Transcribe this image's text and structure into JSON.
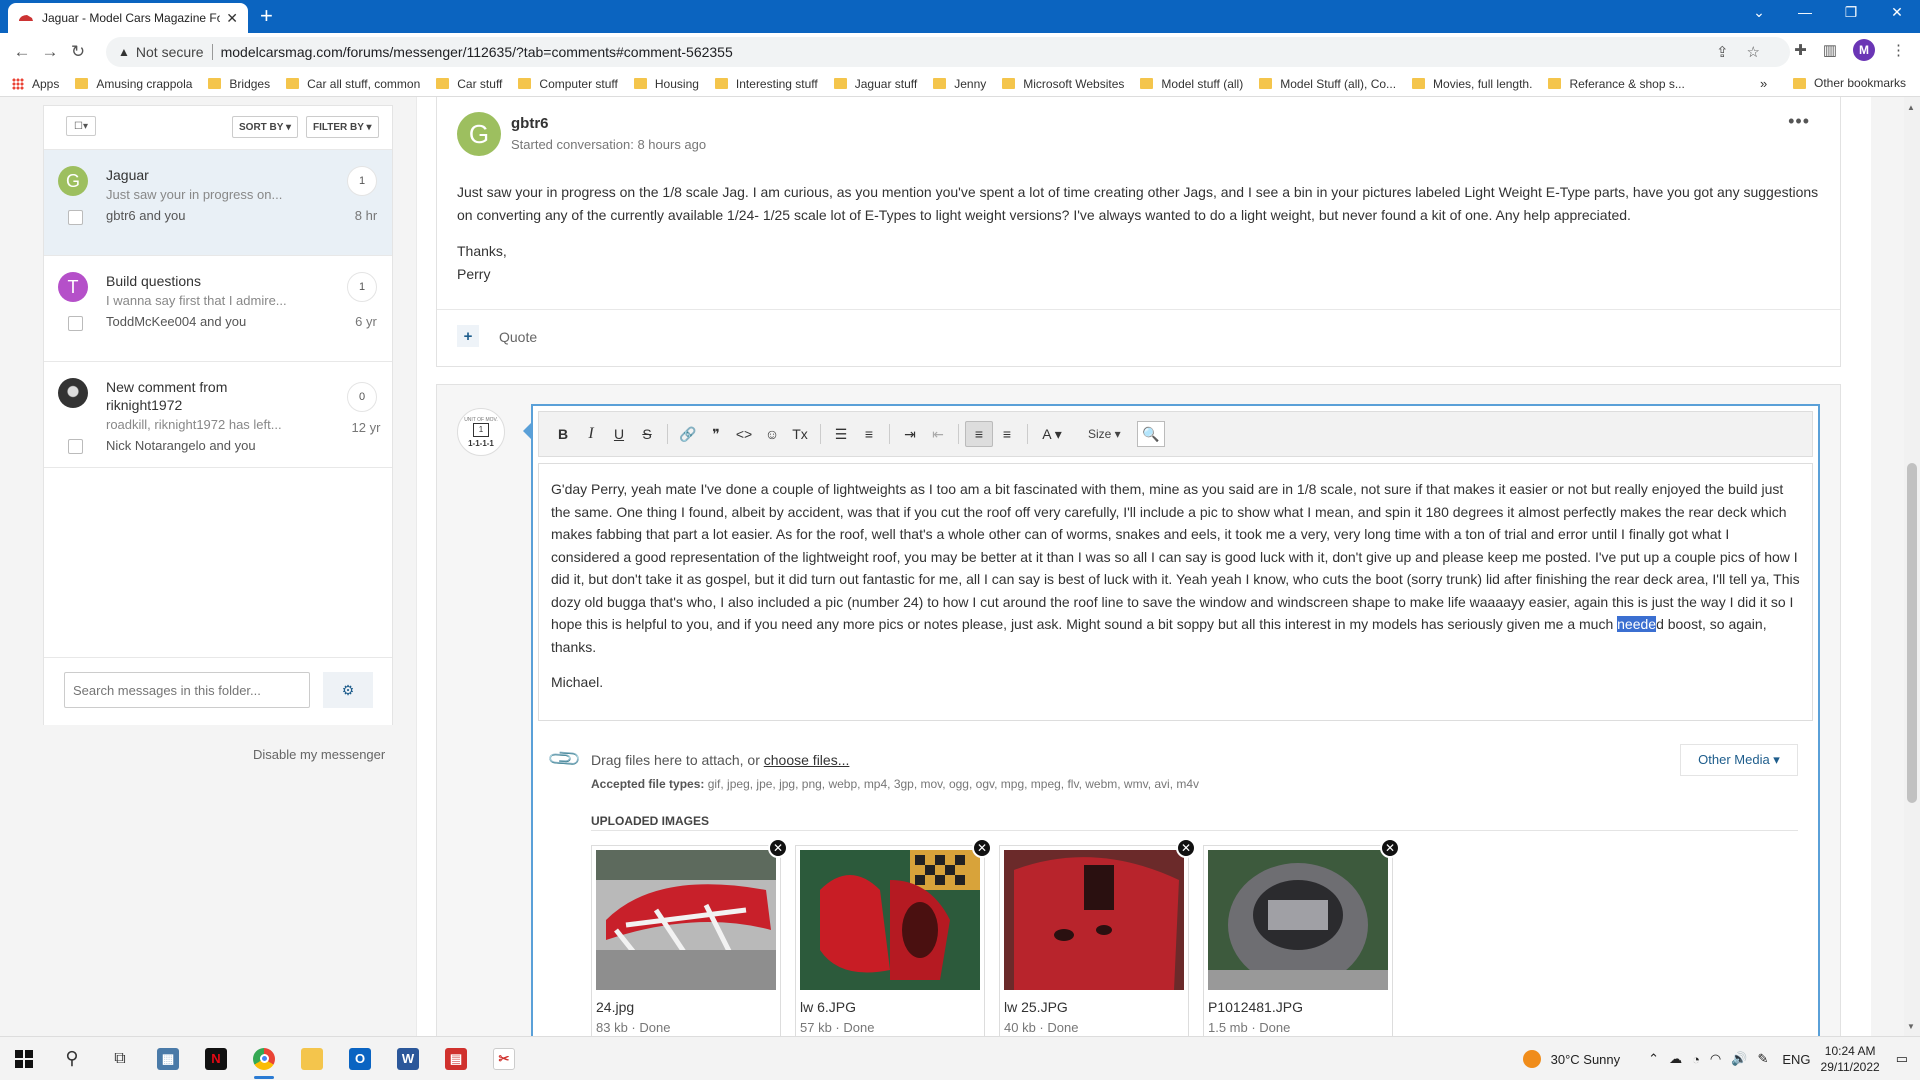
{
  "browser": {
    "tab_title": "Jaguar - Model Cars Magazine Fo",
    "tab_close": "✕",
    "new_tab": "+",
    "security": "Not secure",
    "url": "modelcarsmag.com/forums/messenger/112635/?tab=comments#comment-562355",
    "profile_initial": "M",
    "bookmarks": [
      "Apps",
      "Amusing crappola",
      "Bridges",
      "Car all stuff, common",
      "Car stuff",
      "Computer stuff",
      "Housing",
      "Interesting stuff",
      "Jaguar stuff",
      "Jenny",
      "Microsoft Websites",
      "Model stuff (all)",
      "Model Stuff (all), Co...",
      "Movies, full length.",
      "Referance & shop s..."
    ],
    "bookmarks_more": "»",
    "other_bookmarks": "Other bookmarks"
  },
  "sidebar": {
    "sort_label": "SORT BY ▾",
    "filter_label": "FILTER BY ▾",
    "conversations": [
      {
        "avatar": "G",
        "avatar_color": "#9dbf5f",
        "title": "Jaguar",
        "snippet": "Just saw your in progress on...",
        "participants": "gbtr6 and you",
        "count": "1",
        "age": "8 hr"
      },
      {
        "avatar": "T",
        "avatar_color": "#b550c9",
        "title": "Build questions",
        "snippet": "I wanna say first that I admire...",
        "participants": "ToddMcKee004 and you",
        "count": "1",
        "age": "6 yr"
      },
      {
        "avatar": "",
        "avatar_color": "#333333",
        "title": "New comment from riknight1972",
        "snippet": "roadkill, riknight1972 has left...",
        "participants": "Nick Notarangelo and you",
        "count": "0",
        "age": "12 yr"
      }
    ],
    "search_placeholder": "Search messages in this folder...",
    "disable_link": "Disable my messenger"
  },
  "post": {
    "avatar": "G",
    "author": "gbtr6",
    "meta": "Started conversation: 8 hours ago",
    "more": "•••",
    "paragraphs": [
      "Just saw your in progress on the 1/8 scale Jag. I am curious, as you mention you've spent a lot of time creating other Jags, and I see a bin in your pictures labeled Light Weight E-Type parts, have you got any suggestions on converting any of the currently available 1/24- 1/25 scale lot of E-Types to light weight versions? I've always wanted to do a light weight, but never found a kit of one. Any help appreciated.",
      "Thanks,",
      "Perry"
    ],
    "plus": "+",
    "quote_label": "Quote"
  },
  "reply": {
    "stamp_top": "UNIT OF MOV.",
    "stamp_glyph": "1",
    "stamp_bottom": "1-1-1-1",
    "toolbar": {
      "bold": "B",
      "italic": "I",
      "underline": "U",
      "strike": "S",
      "link": "🔗",
      "quote": "❞",
      "code": "<>",
      "emoji": "☺",
      "clear": "Tx",
      "bullets": "☰",
      "numbers": "≡",
      "indent": "⇥",
      "outdent": "⇤",
      "align_left": "≡",
      "align_center": "≡",
      "color": "A ▾",
      "size": "Size ▾",
      "preview": "🔍"
    },
    "text_before": "G'day Perry, yeah mate I've done a couple of lightweights as I too am a bit fascinated with them, mine as you said are in 1/8 scale, not sure if that makes it easier or not but really enjoyed the build just the same. One thing I found, albeit by accident, was that if you cut the roof off very carefully, I'll include a pic to show what I mean, and spin it 180 degrees it almost perfectly makes the rear deck which makes fabbing that part a lot easier. As for the roof, well that's a whole other can of worms, snakes and eels, it took me a very, very long time with a ton of trial and error until I finally got what I considered a good representation of the lightweight roof, you may be better at it than I was so all I can say is good luck with it, don't give up and please keep me posted. I've put up a couple pics of how I did it, but don't take it as gospel, but it did turn out fantastic for me, all I can say is best of luck with it. Yeah yeah I know, who cuts the boot (sorry trunk) lid after finishing the rear deck area, I'll tell ya, This dozy old bugga that's who, I also included a pic (number 24) to how I cut around the roof line to save the window and windscreen shape to make life waaaayy easier, again this is just the way I did it so I hope this is helpful to you, and if you need any more pics or notes please, just ask. Might sound a bit soppy but all this interest in my models has seriously given me a much ",
    "text_selected": "neede",
    "text_after": "d boost, so again, thanks.",
    "signoff": "Michael.",
    "drag_text": "Drag files here to attach, or ",
    "choose_files": "choose files...",
    "accepted_label": "Accepted file types:",
    "accepted_types": " gif, jpeg, jpe, jpg, png, webp, mp4, 3gp, mov, ogg, ogv, mpg, mpeg, flv, webm, wmv, avi, m4v",
    "other_media": "Other Media ▾",
    "uploaded_label": "UPLOADED IMAGES",
    "images": [
      {
        "name": "24.jpg",
        "size": "83 kb · Done"
      },
      {
        "name": "lw 6.JPG",
        "size": "57 kb · Done"
      },
      {
        "name": "lw 25.JPG",
        "size": "40 kb · Done"
      },
      {
        "name": "P1012481.JPG",
        "size": "1.5 mb · Done"
      }
    ]
  },
  "taskbar": {
    "weather": "30°C  Sunny",
    "lang": "ENG",
    "time": "10:24 AM",
    "date": "29/11/2022"
  }
}
